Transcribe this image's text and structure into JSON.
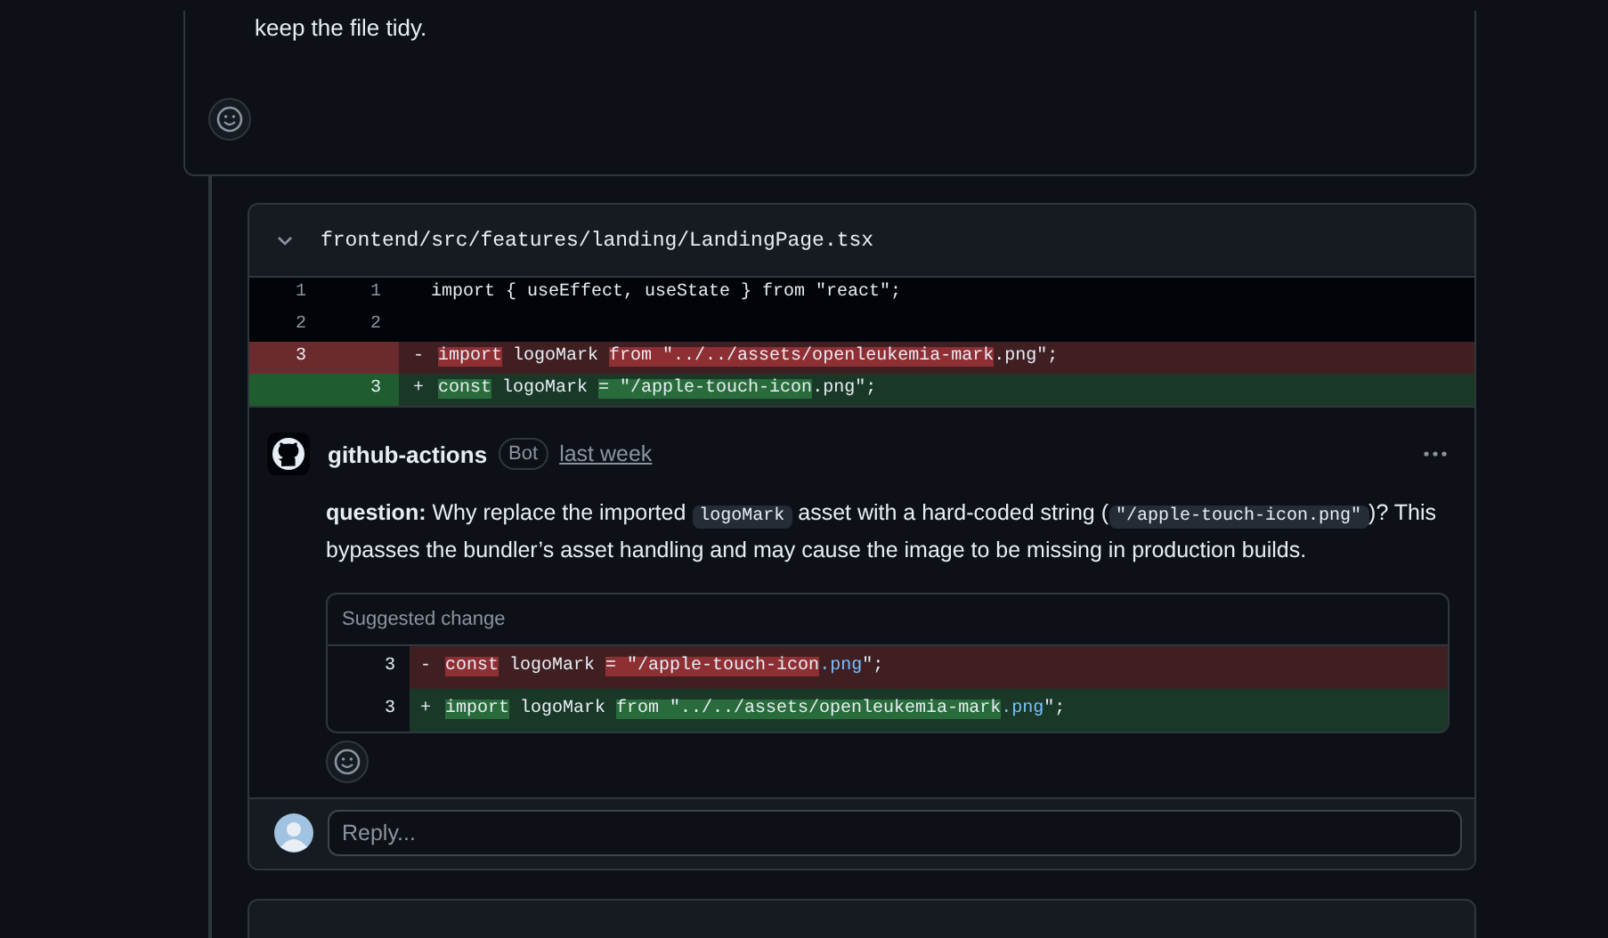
{
  "previous_comment": {
    "text": "keep the file tidy."
  },
  "file": {
    "path": "frontend/src/features/landing/LandingPage.tsx",
    "expanded": true,
    "lines": [
      {
        "kind": "context",
        "old": "1",
        "new": "1",
        "segments": [
          {
            "text": "import { useEffect, useState } from \"react\";",
            "mark": false
          }
        ]
      },
      {
        "kind": "context",
        "old": "2",
        "new": "2"
      },
      {
        "kind": "del",
        "old": "3",
        "sign": "-",
        "segments": [
          {
            "text": "import",
            "mark": true
          },
          {
            "text": " logoMark ",
            "mark": false
          },
          {
            "text": "from",
            "mark": true
          },
          {
            "text": " \"../../assets/openleukemia-mark",
            "mark": true
          },
          {
            "text": ".png\";",
            "mark": false
          }
        ]
      },
      {
        "kind": "add",
        "new": "3",
        "sign": "+",
        "segments": [
          {
            "text": "const",
            "mark": true
          },
          {
            "text": " logoMark ",
            "mark": false
          },
          {
            "text": "= \"/apple-touch-icon",
            "mark": true
          },
          {
            "text": ".png\";",
            "mark": false
          }
        ]
      }
    ]
  },
  "comment": {
    "author": "github-actions",
    "badge": "Bot",
    "time": "last week",
    "body": [
      {
        "kind": "bold",
        "text": "question:"
      },
      {
        "kind": "text",
        "text": " Why replace the imported "
      },
      {
        "kind": "code",
        "text": "logoMark"
      },
      {
        "kind": "text",
        "text": " asset with a hard-coded string ("
      },
      {
        "kind": "code",
        "text": "\"/apple-touch-icon.png\""
      },
      {
        "kind": "text",
        "text": ")? This bypasses the bundler’s asset handling and may cause the image to be missing in production builds."
      }
    ],
    "suggestion": {
      "title": "Suggested change",
      "lines": [
        {
          "kind": "del",
          "num": "3",
          "sign": "-",
          "segments": [
            {
              "text": "const",
              "kind": "mark"
            },
            {
              "text": " logoMark ",
              "kind": "plain"
            },
            {
              "text": "= \"/apple-touch-icon",
              "kind": "mark"
            },
            {
              "text": ".png",
              "kind": "ext"
            },
            {
              "text": "\";",
              "kind": "plain"
            }
          ]
        },
        {
          "kind": "add",
          "num": "3",
          "sign": "+",
          "segments": [
            {
              "text": "import",
              "kind": "mark"
            },
            {
              "text": " logoMark ",
              "kind": "plain"
            },
            {
              "text": "from \"../../assets/openleukemia-mark",
              "kind": "mark"
            },
            {
              "text": ".png",
              "kind": "ext"
            },
            {
              "text": "\";",
              "kind": "plain"
            }
          ]
        }
      ]
    }
  },
  "reply": {
    "placeholder": "Reply..."
  }
}
